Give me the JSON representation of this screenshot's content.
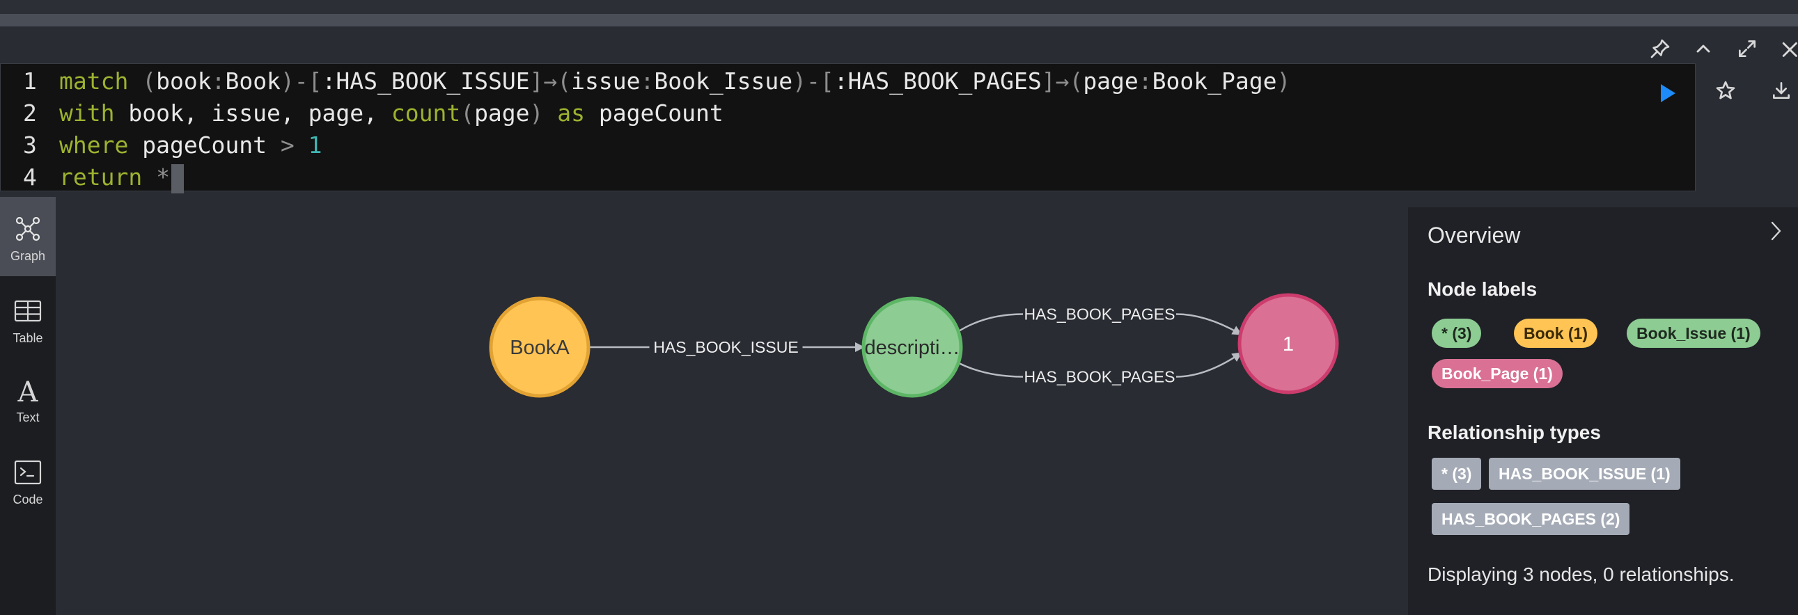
{
  "editor": {
    "lines": [
      {
        "num": "1",
        "tokens": [
          {
            "t": "match",
            "c": "kw"
          },
          {
            "t": " ",
            "c": "txt"
          },
          {
            "t": "(",
            "c": "punc"
          },
          {
            "t": "book",
            "c": "txt"
          },
          {
            "t": ":",
            "c": "punc"
          },
          {
            "t": "Book",
            "c": "txt"
          },
          {
            "t": ")-[",
            "c": "punc"
          },
          {
            "t": ":HAS_BOOK_ISSUE",
            "c": "txt"
          },
          {
            "t": "]→(",
            "c": "punc"
          },
          {
            "t": "issue",
            "c": "txt"
          },
          {
            "t": ":",
            "c": "punc"
          },
          {
            "t": "Book_Issue",
            "c": "txt"
          },
          {
            "t": ")-[",
            "c": "punc"
          },
          {
            "t": ":HAS_BOOK_PAGES",
            "c": "txt"
          },
          {
            "t": "]→(",
            "c": "punc"
          },
          {
            "t": "page",
            "c": "txt"
          },
          {
            "t": ":",
            "c": "punc"
          },
          {
            "t": "Book_Page",
            "c": "txt"
          },
          {
            "t": ")",
            "c": "punc"
          }
        ]
      },
      {
        "num": "2",
        "tokens": [
          {
            "t": "with",
            "c": "kw"
          },
          {
            "t": " book, issue, page, ",
            "c": "txt"
          },
          {
            "t": "count",
            "c": "kw"
          },
          {
            "t": "(",
            "c": "punc"
          },
          {
            "t": "page",
            "c": "txt"
          },
          {
            "t": ")",
            "c": "punc"
          },
          {
            "t": " ",
            "c": "txt"
          },
          {
            "t": "as",
            "c": "kw"
          },
          {
            "t": " pageCount",
            "c": "txt"
          }
        ]
      },
      {
        "num": "3",
        "tokens": [
          {
            "t": "where",
            "c": "kw"
          },
          {
            "t": " pageCount ",
            "c": "txt"
          },
          {
            "t": ">",
            "c": "punc"
          },
          {
            "t": " ",
            "c": "txt"
          },
          {
            "t": "1",
            "c": "num"
          }
        ]
      },
      {
        "num": "4",
        "tokens": [
          {
            "t": "return",
            "c": "kw"
          },
          {
            "t": " ",
            "c": "txt"
          },
          {
            "t": "*",
            "c": "punc"
          }
        ],
        "cursor": true
      }
    ]
  },
  "toolbar": {
    "pin_icon": "pin-icon",
    "collapse_icon": "chevron-up-icon",
    "fullscreen_icon": "expand-icon",
    "close_icon": "close-icon",
    "run_icon": "play-icon",
    "favorite_icon": "star-icon",
    "download_icon": "download-icon"
  },
  "sidebar": {
    "items": [
      {
        "label": "Graph",
        "icon": "graph-icon",
        "active": true
      },
      {
        "label": "Table",
        "icon": "table-icon",
        "active": false
      },
      {
        "label": "Text",
        "icon": "text-icon",
        "active": false
      },
      {
        "label": "Code",
        "icon": "code-icon",
        "active": false
      }
    ]
  },
  "graph": {
    "nodes": [
      {
        "id": "book",
        "caption": "BookA",
        "color": "#ffc454",
        "stroke": "#e2a333",
        "text": "#3a3a3a"
      },
      {
        "id": "issue",
        "caption": "descripti…",
        "color": "#8dcc93",
        "stroke": "#5db665",
        "text": "#2b2b2b"
      },
      {
        "id": "page",
        "caption": "1",
        "color": "#da7194",
        "stroke": "#cc3c6c",
        "text": "#ffffff"
      }
    ],
    "relationships": [
      {
        "type": "HAS_BOOK_ISSUE",
        "from": "book",
        "to": "issue"
      },
      {
        "type": "HAS_BOOK_PAGES",
        "from": "issue",
        "to": "page"
      },
      {
        "type": "HAS_BOOK_PAGES",
        "from": "issue",
        "to": "page"
      }
    ]
  },
  "overview": {
    "title": "Overview",
    "collapse_icon": "chevron-right-icon",
    "node_labels_heading": "Node labels",
    "node_labels": [
      {
        "label": "* (3)",
        "bg": "#8dcc93",
        "fg": "#1e2a1f"
      },
      {
        "label": "Book (1)",
        "bg": "#ffc454",
        "fg": "#3a2a05"
      },
      {
        "label": "Book_Issue (1)",
        "bg": "#8dcc93",
        "fg": "#1e2a1f"
      },
      {
        "label": "Book_Page (1)",
        "bg": "#da7194",
        "fg": "#ffffff"
      }
    ],
    "rel_types_heading": "Relationship types",
    "rel_types": [
      {
        "label": "* (3)"
      },
      {
        "label": "HAS_BOOK_ISSUE (1)"
      },
      {
        "label": "HAS_BOOK_PAGES (2)"
      }
    ],
    "status": "Displaying 3 nodes, 0 relationships."
  }
}
